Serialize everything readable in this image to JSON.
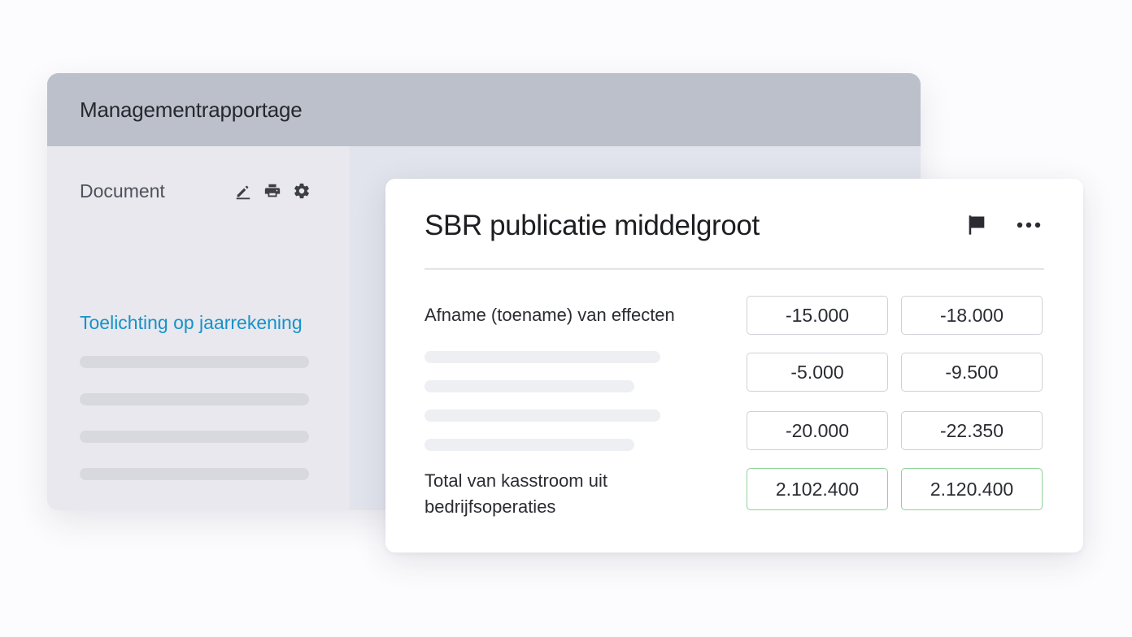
{
  "back_window": {
    "title": "Managementrapportage",
    "sidebar": {
      "heading": "Document",
      "icons": [
        "edit-icon",
        "print-icon",
        "settings-icon"
      ],
      "link": "Toelichting op jaarrekening"
    }
  },
  "card": {
    "title": "SBR publicatie middelgroot",
    "icons": [
      "flag-icon",
      "more-icon"
    ],
    "rows": [
      {
        "label": "Afname (toename) van effecten",
        "values": [
          "-15.000",
          "-18.000"
        ]
      },
      {
        "label": "",
        "values": [
          "-5.000",
          "-9.500"
        ]
      },
      {
        "label": "",
        "values": [
          "-20.000",
          "-22.350"
        ]
      }
    ],
    "total": {
      "label_line1": "Total van kasstroom uit",
      "label_line2": "bedrijfsoperaties",
      "values": [
        "2.102.400",
        "2.120.400"
      ]
    }
  }
}
